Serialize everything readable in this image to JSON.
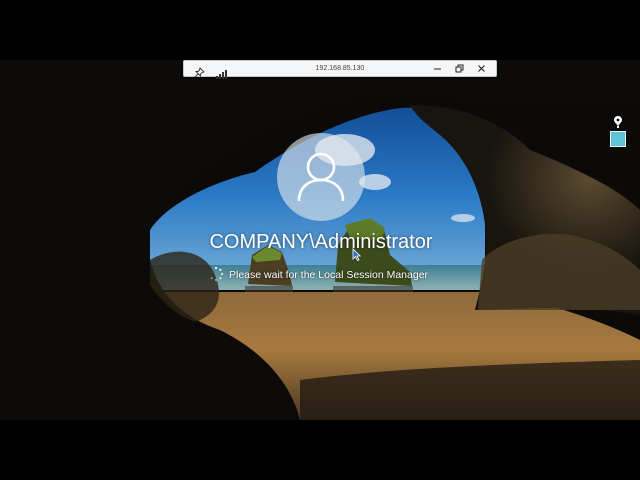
{
  "remote_bar": {
    "host": "192.168.85.130",
    "pin_icon": "pin-icon",
    "signal_icon": "connection-signal-icon",
    "minimize_icon": "minimize-icon",
    "restore_icon": "restore-icon",
    "close_icon": "close-icon"
  },
  "lock_screen": {
    "username": "COMPANY\\Administrator",
    "status": "Please wait for the Local Session Manager",
    "avatar_icon": "user-icon",
    "spinner_icon": "loading-spinner-icon"
  },
  "side_tray": {
    "pen_icon": "pen-icon",
    "image_icon": "image-thumbnail-icon"
  },
  "colors": {
    "sky": "#1a63ad",
    "sand": "#a87a44",
    "rock": "#1c1a16",
    "text": "#ffffff"
  }
}
